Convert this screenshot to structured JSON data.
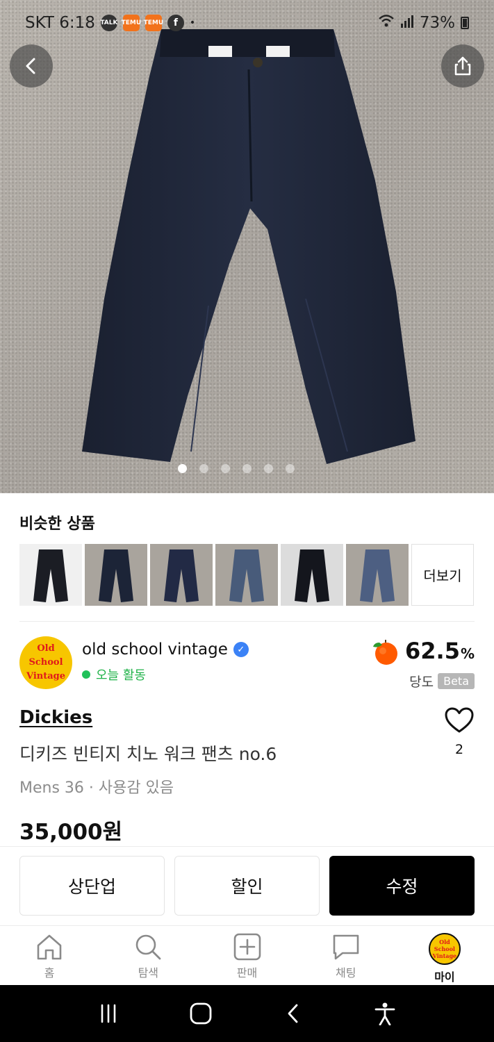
{
  "status_bar": {
    "carrier_time": "SKT 6:18",
    "notifications": [
      "TALK",
      "TEMU",
      "TEMU",
      "f"
    ],
    "battery": "73%"
  },
  "photo_carousel": {
    "total": 6,
    "active_index": 0
  },
  "similar": {
    "title": "비슷한 상품",
    "more_label": "더보기",
    "thumb_colors": [
      "#1b1d24",
      "#1c2437",
      "#222a45",
      "#485b7a",
      "#14161d",
      "#4d5f82"
    ]
  },
  "seller": {
    "avatar_lines": [
      "Old",
      "School",
      "Vintage"
    ],
    "name": "old school vintage",
    "activity": "오늘 활동",
    "sweetness_value": "62.5",
    "sweetness_unit": "%",
    "sweetness_label": "당도",
    "beta_label": "Beta"
  },
  "product": {
    "brand": "Dickies",
    "title": "디키즈 빈티지 치노 워크 팬츠 no.6",
    "meta": "Mens 36 · 사용감 있음",
    "price": "35,000원",
    "likes": "2"
  },
  "actions": {
    "bump": "상단업",
    "discount": "할인",
    "edit": "수정"
  },
  "bottom_nav": {
    "home": "홈",
    "search": "탐색",
    "sell": "판매",
    "chat": "채팅",
    "my": "마이"
  },
  "colors": {
    "accent_green": "#21b34a",
    "verified_blue": "#3b82f6",
    "avatar_yellow": "#f7c600",
    "avatar_red": "#e01a1a"
  }
}
